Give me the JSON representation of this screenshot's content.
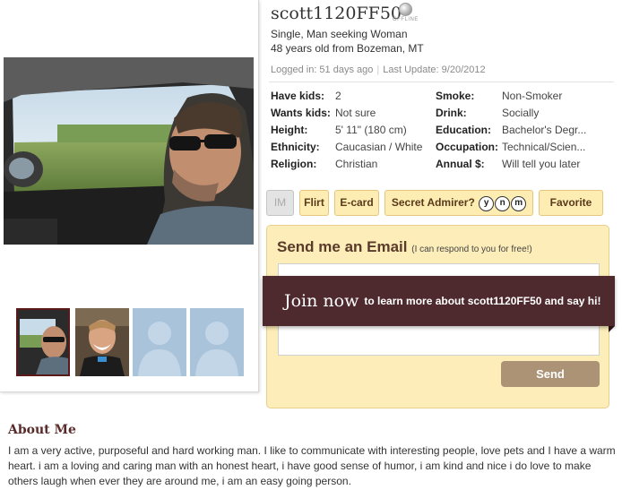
{
  "profile": {
    "username": "scott1120FF50",
    "status": "OFFLINE",
    "tagline": "Single, Man seeking Woman",
    "age_location": "48 years old from Bozeman, MT",
    "logged_in": "Logged in: 51 days ago",
    "last_update": "Last Update: 9/20/2012"
  },
  "details": [
    {
      "label1": "Have kids:",
      "value1": "2",
      "label2": "Smoke:",
      "value2": "Non-Smoker"
    },
    {
      "label1": "Wants kids:",
      "value1": "Not sure",
      "label2": "Drink:",
      "value2": "Socially"
    },
    {
      "label1": "Height:",
      "value1": "5' 11\" (180 cm)",
      "label2": "Education:",
      "value2": "Bachelor's Degr..."
    },
    {
      "label1": "Ethnicity:",
      "value1": "Caucasian / White",
      "label2": "Occupation:",
      "value2": "Technical/Scien..."
    },
    {
      "label1": "Religion:",
      "value1": "Christian",
      "label2": "Annual $:",
      "value2": "Will tell you later"
    }
  ],
  "actions": {
    "im": "IM",
    "flirt": "Flirt",
    "ecard": "E-card",
    "secret_admirer": "Secret Admirer?",
    "ynm": [
      "y",
      "n",
      "m"
    ],
    "favorite": "Favorite"
  },
  "email": {
    "title": "Send me an Email",
    "subtitle": "(I can respond to you for free!)",
    "send": "Send"
  },
  "join": {
    "big": "Join now",
    "small": "to learn more about scott1120FF50 and say hi!"
  },
  "about": {
    "title": "About Me",
    "text": "I am a very active, purposeful and hard working man. I like to communicate with interesting people, love pets and I have a warm heart. i am a loving and caring man with an honest heart, i have good sense of humor, i am kind and nice i do love to make others laugh when ever they are around me, i am an easy going person."
  },
  "colors": {
    "accent_dark": "#4e2a2f",
    "button_bg": "#fdedb2",
    "email_bg": "#fdedb8",
    "send_bg": "#ad9376"
  },
  "icons": {
    "status": "status-offline-icon",
    "placeholder": "silhouette-placeholder-icon"
  }
}
